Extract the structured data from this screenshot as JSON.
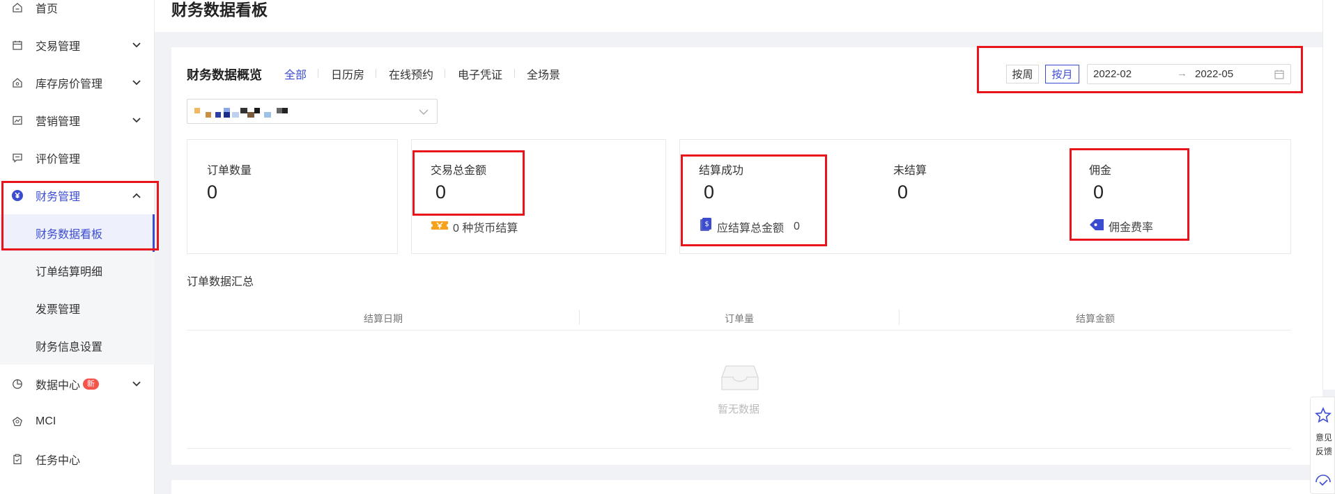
{
  "sidebar": {
    "items": [
      {
        "label": "首页",
        "icon": "home-icon"
      },
      {
        "label": "交易管理",
        "icon": "calendar-icon"
      },
      {
        "label": "库存房价管理",
        "icon": "house-icon"
      },
      {
        "label": "营销管理",
        "icon": "trend-icon"
      },
      {
        "label": "评价管理",
        "icon": "comment-icon"
      },
      {
        "label": "财务管理",
        "icon": "yen-icon"
      },
      {
        "label": "数据中心",
        "icon": "pie-icon",
        "badge": "新"
      },
      {
        "label": "MCI",
        "icon": "pentagon-icon"
      },
      {
        "label": "任务中心",
        "icon": "clipboard-icon"
      }
    ],
    "finance_sub": [
      {
        "label": "财务数据看板"
      },
      {
        "label": "订单结算明细"
      },
      {
        "label": "发票管理"
      },
      {
        "label": "财务信息设置"
      }
    ]
  },
  "page": {
    "title": "财务数据看板"
  },
  "overview": {
    "title": "财务数据概览",
    "tabs": [
      "全部",
      "日历房",
      "在线预约",
      "电子凭证",
      "全场景"
    ],
    "active_tab": "全部",
    "period_buttons": [
      "按周",
      "按月"
    ],
    "active_period": "按月",
    "range_from": "2022-02",
    "range_to": "2022-05",
    "range_arrow": "→"
  },
  "stats": {
    "order_count_label": "订单数量",
    "order_count_value": "0",
    "trade_total_label": "交易总金额",
    "trade_total_value": "0",
    "currency_note": "0 种货币结算",
    "settled_label": "结算成功",
    "settled_value": "0",
    "payable_label": "应结算总金额",
    "payable_value": "0",
    "unsettled_label": "未结算",
    "unsettled_value": "0",
    "commission_label": "佣金",
    "commission_value": "0",
    "commission_rate_label": "佣金费率"
  },
  "summary": {
    "title": "订单数据汇总",
    "columns": [
      "结算日期",
      "订单量",
      "结算金额"
    ],
    "empty_text": "暂无数据"
  },
  "float_panel": {
    "line1": "意见",
    "line2": "反馈"
  },
  "colors": {
    "accent": "#3b4cd1",
    "highlight": "#e8131b",
    "badge": "#f5544d"
  }
}
